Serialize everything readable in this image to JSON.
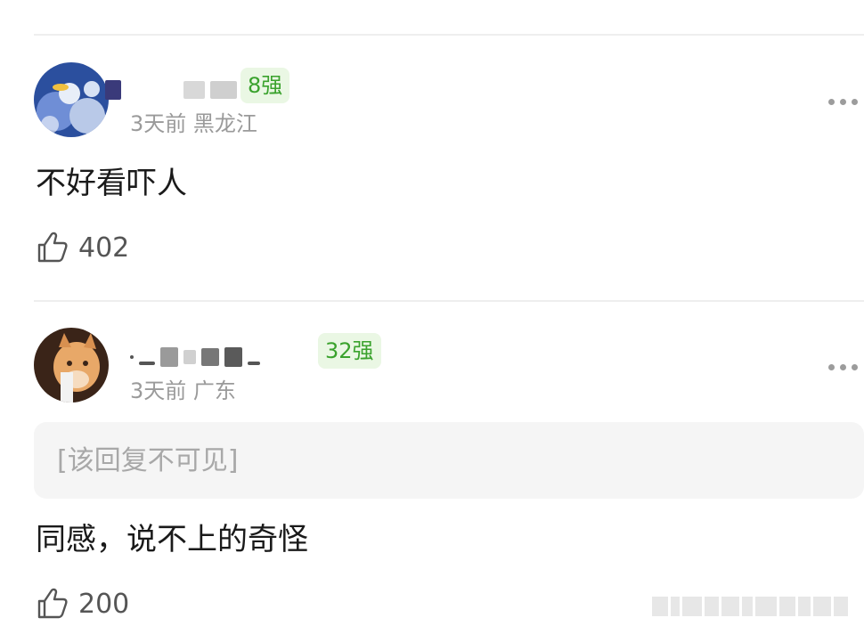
{
  "comments": [
    {
      "username_visible": "8强",
      "badge": "8强",
      "time": "3天前",
      "location": "黑龙江",
      "text": "不好看吓人",
      "likes": "402",
      "avatar_icon": "ocean-fish-avatar",
      "hidden_reply": null
    },
    {
      "badge": "32强",
      "time": "3天前",
      "location": "广东",
      "text": "同感，说不上的奇怪",
      "likes": "200",
      "avatar_icon": "cat-avatar",
      "hidden_reply": "[该回复不可见]"
    }
  ],
  "colors": {
    "badge_green": "#3aa22d",
    "badge_bg": "#eaf7e4",
    "meta_gray": "#9a9a9a",
    "hidden_bg": "#f5f5f5"
  },
  "icons": [
    "thumbs-up-icon",
    "more-dots-icon"
  ]
}
